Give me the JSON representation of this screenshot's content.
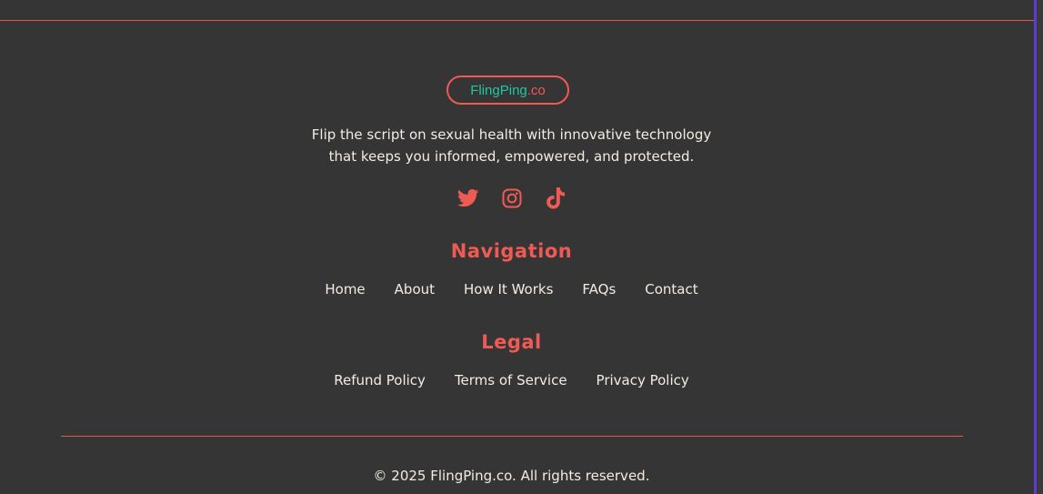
{
  "logo": {
    "main": "FlingPing",
    "tld": ".co"
  },
  "tagline": {
    "line1": "Flip the script on sexual health with innovative technology",
    "line2": "that keeps you informed, empowered, and protected."
  },
  "socials": [
    "twitter-icon",
    "instagram-icon",
    "tiktok-icon"
  ],
  "navigation": {
    "title": "Navigation",
    "links": [
      "Home",
      "About",
      "How It Works",
      "FAQs",
      "Contact"
    ]
  },
  "legal": {
    "title": "Legal",
    "links": [
      "Refund Policy",
      "Terms of Service",
      "Privacy Policy"
    ]
  },
  "copyright": "© 2025 FlingPing.co. All rights reserved.",
  "colors": {
    "background": "#353535",
    "accent": "#ef5a55",
    "logo_teal": "#23c6a4",
    "text": "#f3ece3"
  }
}
